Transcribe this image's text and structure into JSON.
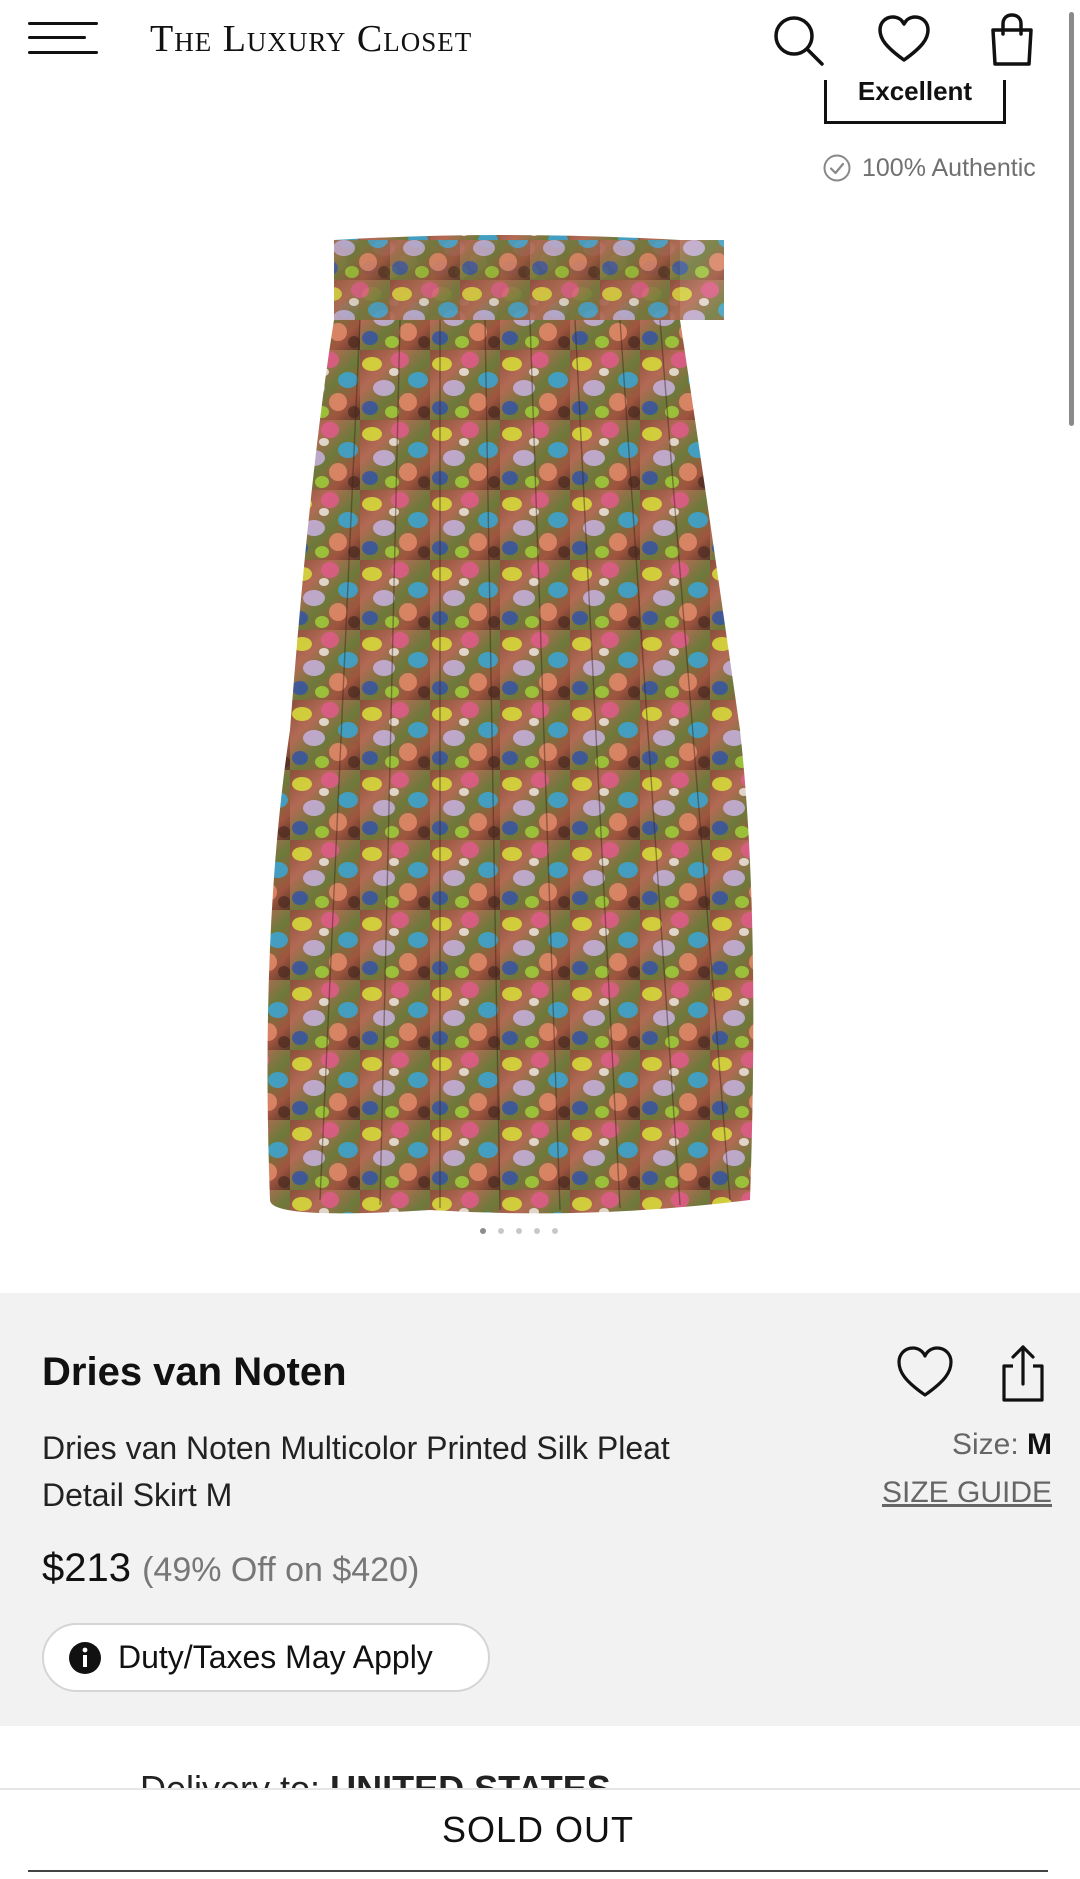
{
  "header": {
    "logo": "The Luxury Closet",
    "menu_icon": "hamburger-menu-icon",
    "search_icon": "search-icon",
    "wishlist_icon": "heart-icon",
    "bag_icon": "shopping-bag-icon"
  },
  "gallery": {
    "condition_badge": "Excellent",
    "authentic_label": "100% Authentic",
    "image_alt": "Multicolor printed silk pleated skirt",
    "slide_count": 5,
    "active_slide": 1
  },
  "product": {
    "brand": "Dries van Noten",
    "title": "Dries van Noten Multicolor Printed Silk Pleat Detail Skirt M",
    "size_label": "Size:",
    "size_value": "M",
    "size_guide": "SIZE GUIDE",
    "price": "$213",
    "discount_text": "(49% Off on $420)",
    "duty_note": "Duty/Taxes May Apply"
  },
  "delivery": {
    "label": "Delivery to:",
    "country": "UNITED STATES"
  },
  "actions": {
    "sold_out_label": "SOLD OUT"
  },
  "colors": {
    "info_bg": "#f2f2f2",
    "text": "#111111",
    "muted": "#777777"
  }
}
